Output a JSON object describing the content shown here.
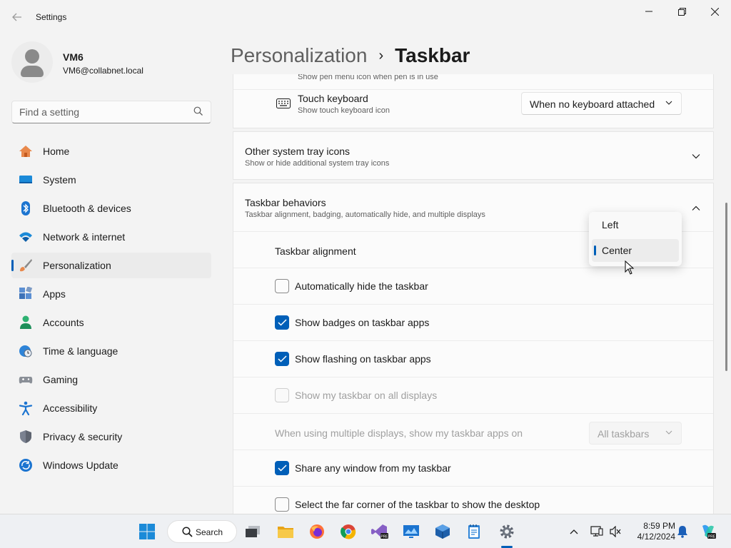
{
  "window": {
    "title": "Settings",
    "back_icon": "back-arrow-icon",
    "controls": [
      "minimize",
      "maximize",
      "close"
    ]
  },
  "user": {
    "name": "VM6",
    "email": "VM6@collabnet.local"
  },
  "search": {
    "placeholder": "Find a setting"
  },
  "sidebar": {
    "items": [
      {
        "label": "Home",
        "icon": "home-icon"
      },
      {
        "label": "System",
        "icon": "system-icon"
      },
      {
        "label": "Bluetooth & devices",
        "icon": "bluetooth-icon"
      },
      {
        "label": "Network & internet",
        "icon": "wifi-icon"
      },
      {
        "label": "Personalization",
        "icon": "brush-icon",
        "active": true
      },
      {
        "label": "Apps",
        "icon": "apps-icon"
      },
      {
        "label": "Accounts",
        "icon": "accounts-icon"
      },
      {
        "label": "Time & language",
        "icon": "clock-globe-icon"
      },
      {
        "label": "Gaming",
        "icon": "gamepad-icon"
      },
      {
        "label": "Accessibility",
        "icon": "accessibility-icon"
      },
      {
        "label": "Privacy & security",
        "icon": "shield-icon"
      },
      {
        "label": "Windows Update",
        "icon": "update-icon"
      }
    ]
  },
  "breadcrumb": {
    "parent": "Personalization",
    "separator": "›",
    "current": "Taskbar"
  },
  "tray_section": {
    "pen_menu_sub": "Show pen menu icon when pen is in use",
    "touch_keyboard": {
      "title": "Touch keyboard",
      "sub": "Show touch keyboard icon",
      "value": "When no keyboard attached"
    }
  },
  "other_tray": {
    "title": "Other system tray icons",
    "sub": "Show or hide additional system tray icons"
  },
  "behaviors": {
    "title": "Taskbar behaviors",
    "sub": "Taskbar alignment, badging, automatically hide, and multiple displays",
    "alignment_label": "Taskbar alignment",
    "alignment_options": [
      "Left",
      "Center"
    ],
    "alignment_selected": "Center",
    "options": [
      {
        "label": "Automatically hide the taskbar",
        "checked": false,
        "disabled": false
      },
      {
        "label": "Show badges on taskbar apps",
        "checked": true,
        "disabled": false
      },
      {
        "label": "Show flashing on taskbar apps",
        "checked": true,
        "disabled": false
      },
      {
        "label": "Show my taskbar on all displays",
        "checked": false,
        "disabled": true
      }
    ],
    "multi_display_label": "When using multiple displays, show my taskbar apps on",
    "multi_display_value": "All taskbars",
    "options2": [
      {
        "label": "Share any window from my taskbar",
        "checked": true,
        "disabled": false
      },
      {
        "label": "Select the far corner of the taskbar to show the desktop",
        "checked": false,
        "disabled": false
      }
    ]
  },
  "taskbar": {
    "search_label": "Search",
    "time": "8:59 PM",
    "date": "4/12/2024",
    "apps": [
      "start-icon",
      "task-view-icon",
      "file-explorer-icon",
      "firefox-icon",
      "chrome-icon",
      "visual-studio-icon",
      "remote-desktop-icon",
      "virtualbox-icon",
      "notepad-icon",
      "settings-icon"
    ]
  },
  "colors": {
    "accent": "#005fb8",
    "background": "#f3f3f3",
    "card": "#fbfbfb"
  }
}
